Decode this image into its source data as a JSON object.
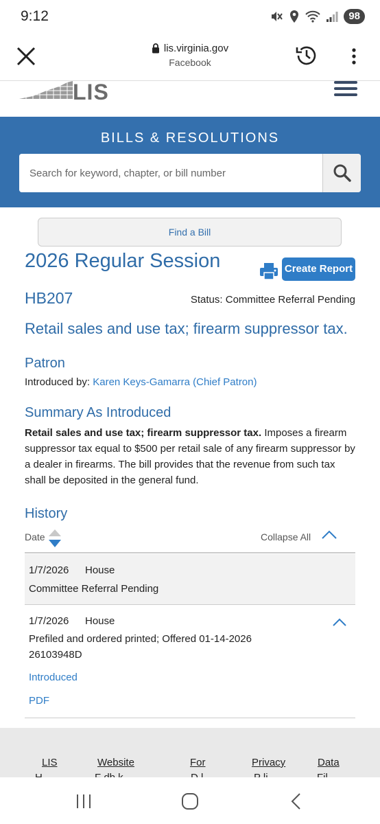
{
  "status_bar": {
    "time": "9:12",
    "battery": "98"
  },
  "browser": {
    "url": "lis.virginia.gov",
    "source": "Facebook"
  },
  "site": {
    "logo_text": "LIS"
  },
  "banner": {
    "title": "BILLS & RESOLUTIONS",
    "search_placeholder": "Search for keyword, chapter, or bill number"
  },
  "find_bill_label": "Find a Bill",
  "session": {
    "title": "2026 Regular Session",
    "create_report_label": "Create Report"
  },
  "bill": {
    "id": "HB207",
    "status": "Status: Committee Referral Pending",
    "caption": "Retail sales and use tax; firearm suppressor tax."
  },
  "patron": {
    "heading": "Patron",
    "introduced_by_label": "Introduced by:",
    "name": "Karen Keys-Gamarra (Chief Patron)"
  },
  "summary": {
    "heading": "Summary As Introduced",
    "bold_lead": "Retail sales and use tax; firearm suppressor tax.",
    "body": " Imposes a firearm suppressor tax equal to $500 per retail sale of any firearm suppressor by a dealer in firearms. The bill provides that the revenue from such tax shall be deposited in the general fund."
  },
  "history": {
    "heading": "History",
    "date_label": "Date",
    "collapse_all_label": "Collapse All",
    "rows": [
      {
        "date": "1/7/2026",
        "chamber": "House",
        "description": "Committee Referral Pending"
      },
      {
        "date": "1/7/2026",
        "chamber": "House",
        "description": "Prefiled and ordered printed; Offered 01-14-2026 26103948D",
        "links": [
          "Introduced",
          "PDF"
        ]
      }
    ]
  },
  "footer": {
    "links": [
      "LIS",
      "Website",
      "For",
      "Privacy",
      "Data"
    ],
    "cut_lines": [
      "H",
      "F  db  k",
      "D   l",
      "P li",
      "Fil"
    ]
  }
}
